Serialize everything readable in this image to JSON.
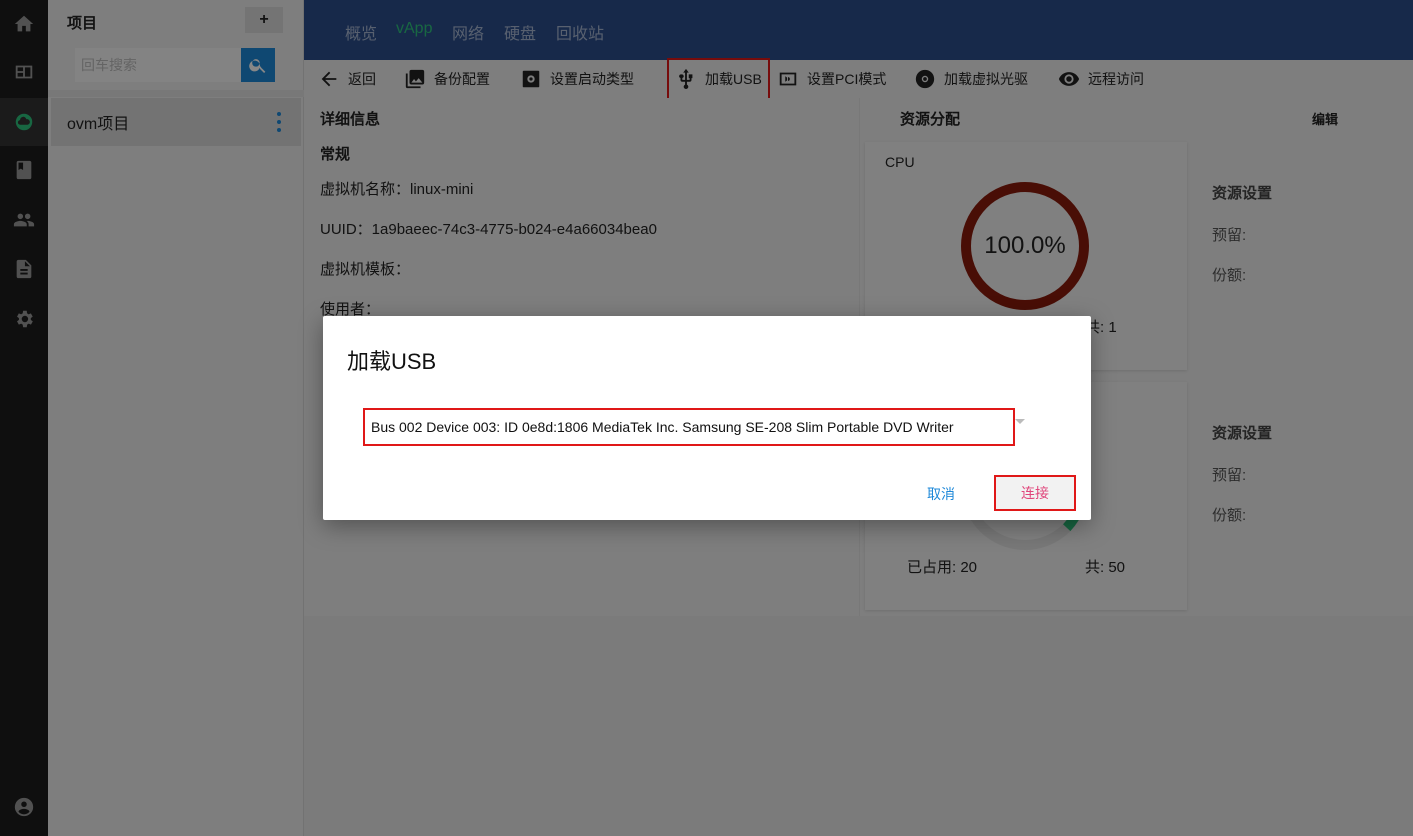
{
  "rail": {
    "icons": [
      "home-icon",
      "dashboard-icon",
      "cloud-icon",
      "book-icon",
      "users-icon",
      "document-icon",
      "settings-icon",
      "account-icon"
    ],
    "active": "cloud-icon"
  },
  "projects": {
    "title": "项目",
    "add_label": "+",
    "search_placeholder": "回车搜索",
    "items": [
      {
        "label": "ovm项目"
      }
    ]
  },
  "topnav": {
    "tabs": [
      {
        "label": "概览"
      },
      {
        "label": "vApp"
      },
      {
        "label": "网络"
      },
      {
        "label": "硬盘"
      },
      {
        "label": "回收站"
      }
    ],
    "active": "vApp"
  },
  "toolbar": {
    "back": "返回",
    "backup": "备份配置",
    "boot_type": "设置启动类型",
    "mount_usb": "加载USB",
    "pci_mode": "设置PCI模式",
    "mount_cdrom": "加载虚拟光驱",
    "remote_access": "远程访问"
  },
  "details": {
    "heading": "详细信息",
    "section": "常规",
    "rows": [
      "虚拟机名称：linux-mini",
      "UUID：1a9baeec-74c3-4775-b024-e4a66034bea0",
      "虚拟机模板：",
      "使用者："
    ]
  },
  "resources": {
    "heading": "资源分配",
    "edit": "编辑",
    "cpu": {
      "title": "CPU",
      "percent_text": "100.0%",
      "total": "共: 1",
      "settings_title": "资源设置",
      "reserve": "预留:",
      "share": "份额:"
    },
    "second": {
      "used": "已占用: 20",
      "total": "共: 50",
      "settings_title": "资源设置",
      "reserve": "预留:",
      "share": "份额:"
    }
  },
  "dialog": {
    "title": "加载USB",
    "selected_device": "Bus 002 Device 003: ID 0e8d:1806 MediaTek Inc. Samsung SE-208 Slim Portable DVD Writer",
    "cancel": "取消",
    "connect": "连接"
  },
  "colors": {
    "nav_bg": "#2c4f8c",
    "accent_green": "#2ec27e",
    "primary_blue": "#1e88d8",
    "gauge_red": "#8a1c0c",
    "highlight_red": "#e01818"
  }
}
